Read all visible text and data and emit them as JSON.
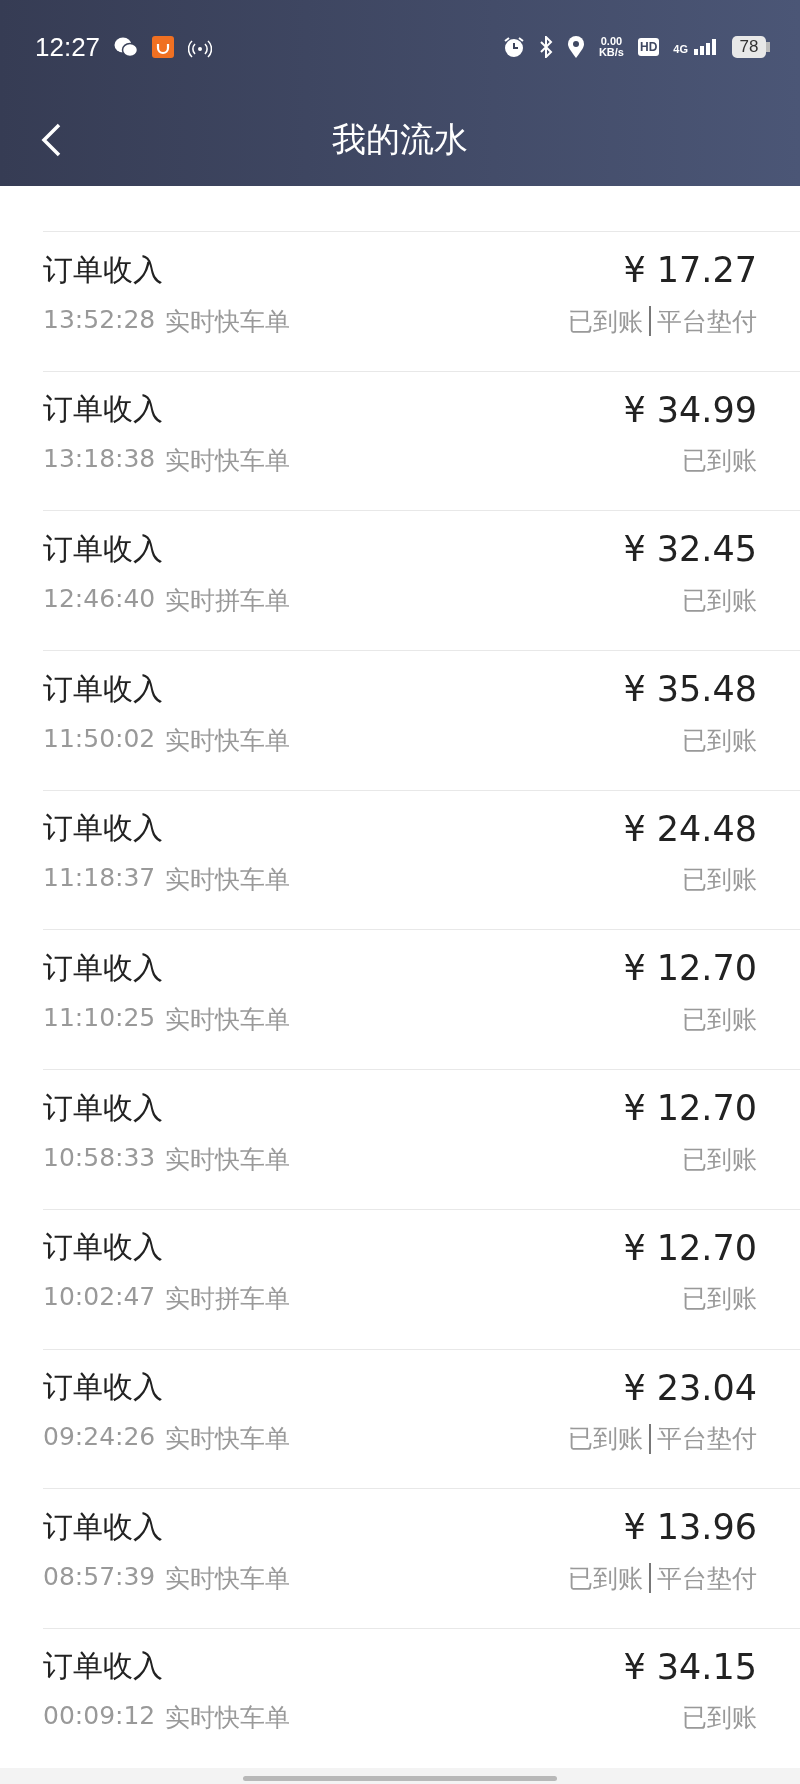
{
  "status_bar": {
    "time": "12:27",
    "net_speed": "0.00",
    "net_unit": "KB/s",
    "hd": "HD",
    "network": "4G",
    "battery": "78"
  },
  "header": {
    "title": "我的流水"
  },
  "rows": [
    {
      "title": "订单收入",
      "time": "13:52:28",
      "type": "实时快车单",
      "amount": "¥ 17.27",
      "statuses": [
        "已到账",
        "平台垫付"
      ]
    },
    {
      "title": "订单收入",
      "time": "13:18:38",
      "type": "实时快车单",
      "amount": "¥ 34.99",
      "statuses": [
        "已到账"
      ]
    },
    {
      "title": "订单收入",
      "time": "12:46:40",
      "type": "实时拼车单",
      "amount": "¥ 32.45",
      "statuses": [
        "已到账"
      ]
    },
    {
      "title": "订单收入",
      "time": "11:50:02",
      "type": "实时快车单",
      "amount": "¥ 35.48",
      "statuses": [
        "已到账"
      ]
    },
    {
      "title": "订单收入",
      "time": "11:18:37",
      "type": "实时快车单",
      "amount": "¥ 24.48",
      "statuses": [
        "已到账"
      ]
    },
    {
      "title": "订单收入",
      "time": "11:10:25",
      "type": "实时快车单",
      "amount": "¥ 12.70",
      "statuses": [
        "已到账"
      ]
    },
    {
      "title": "订单收入",
      "time": "10:58:33",
      "type": "实时快车单",
      "amount": "¥ 12.70",
      "statuses": [
        "已到账"
      ]
    },
    {
      "title": "订单收入",
      "time": "10:02:47",
      "type": "实时拼车单",
      "amount": "¥ 12.70",
      "statuses": [
        "已到账"
      ]
    },
    {
      "title": "订单收入",
      "time": "09:24:26",
      "type": "实时快车单",
      "amount": "¥ 23.04",
      "statuses": [
        "已到账",
        "平台垫付"
      ]
    },
    {
      "title": "订单收入",
      "time": "08:57:39",
      "type": "实时快车单",
      "amount": "¥ 13.96",
      "statuses": [
        "已到账",
        "平台垫付"
      ]
    },
    {
      "title": "订单收入",
      "time": "00:09:12",
      "type": "实时快车单",
      "amount": "¥ 34.15",
      "statuses": [
        "已到账"
      ]
    }
  ]
}
